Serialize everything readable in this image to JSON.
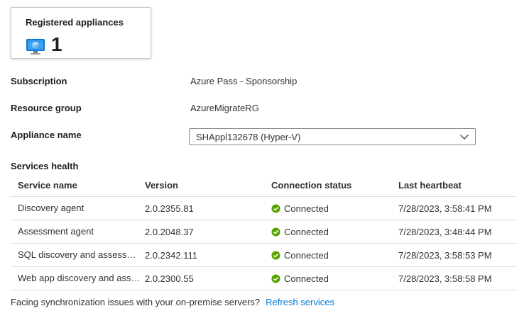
{
  "card": {
    "title": "Registered appliances",
    "count": "1",
    "icon": "appliance-vm-icon"
  },
  "properties": {
    "subscription": {
      "label": "Subscription",
      "value": "Azure Pass - Sponsorship"
    },
    "resource_group": {
      "label": "Resource group",
      "value": "AzureMigrateRG"
    },
    "appliance_name": {
      "label": "Appliance name",
      "value": "SHAppl132678 (Hyper-V)"
    }
  },
  "services_health": {
    "title": "Services health",
    "columns": [
      "Service name",
      "Version",
      "Connection status",
      "Last heartbeat"
    ],
    "rows": [
      {
        "name": "Discovery agent",
        "version": "2.0.2355.81",
        "status": "Connected",
        "heartbeat": "7/28/2023, 3:58:41 PM"
      },
      {
        "name": "Assessment agent",
        "version": "2.0.2048.37",
        "status": "Connected",
        "heartbeat": "7/28/2023, 3:48:44 PM"
      },
      {
        "name": "SQL discovery and assessment agent",
        "version": "2.0.2342.111",
        "status": "Connected",
        "heartbeat": "7/28/2023, 3:58:53 PM"
      },
      {
        "name": "Web app discovery and assessment agent",
        "version": "2.0.2300.55",
        "status": "Connected",
        "heartbeat": "7/28/2023, 3:58:58 PM"
      }
    ]
  },
  "footer": {
    "text": "Facing synchronization issues with your on-premise servers?",
    "link": "Refresh services"
  },
  "colors": {
    "link": "#0078d4",
    "success": "#57a300",
    "border": "#e1dfdd"
  }
}
